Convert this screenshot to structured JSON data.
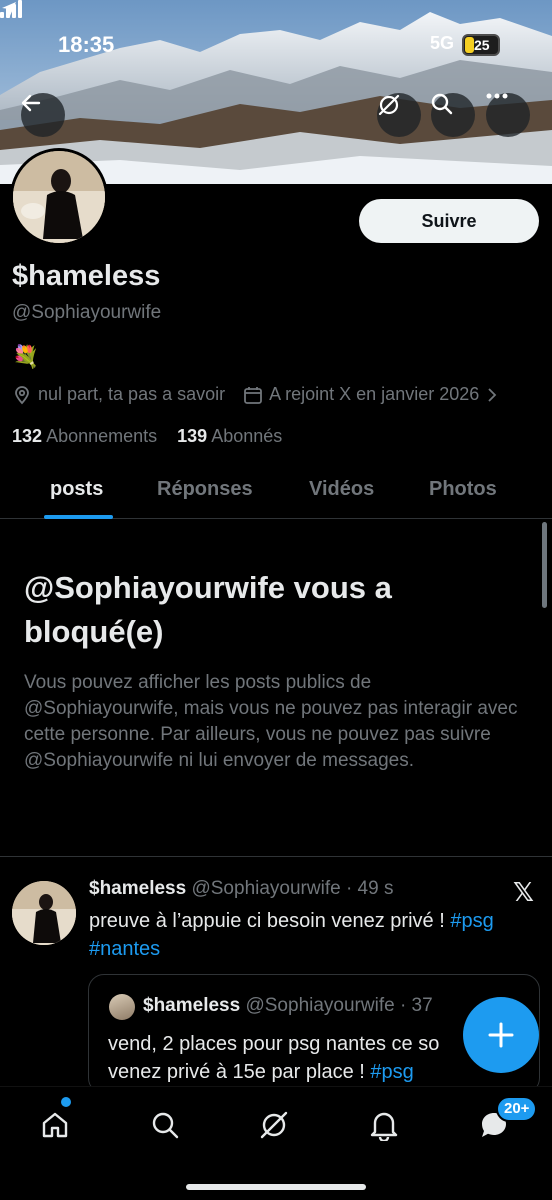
{
  "status_bar": {
    "time": "18:35",
    "network": "5G",
    "battery": "25",
    "battery_level": 0.25,
    "battery_color": "#f5cf22"
  },
  "header": {
    "icons": [
      "back-arrow-icon",
      "grok-icon",
      "search-icon",
      "more-icon"
    ]
  },
  "profile": {
    "follow_label": "Suivre",
    "name": "$hameless",
    "handle": "@Sophiayourwife",
    "bio": "💐",
    "location": "nul part, ta pas a savoir",
    "joined": "A rejoint X en janvier 2026",
    "following_count": "132",
    "following_label": "Abonnements",
    "followers_count": "139",
    "followers_label": "Abonnés"
  },
  "tabs": [
    {
      "label": "posts",
      "active": true
    },
    {
      "label": "Réponses",
      "active": false
    },
    {
      "label": "Vidéos",
      "active": false
    },
    {
      "label": "Photos",
      "active": false
    }
  ],
  "blocked": {
    "title": "@Sophiayourwife vous a bloqué(e)",
    "text": "Vous pouvez afficher les posts publics de @Sophiayourwife, mais vous ne pouvez pas interagir avec cette personne. Par ailleurs, vous ne pouvez pas suivre @Sophiayourwife ni lui envoyer de messages."
  },
  "post": {
    "name": "$hameless",
    "meta": "@Sophiayourwife · 49 s",
    "text": "preuve à l’appuie ci besoin venez privé ! ",
    "tag1": "#psg",
    "tag2": "#nantes",
    "quote": {
      "name": "$hameless",
      "meta": "@Sophiayourwife · 37",
      "text": "vend, 2 places pour psg nantes ce so",
      "text2": "venez privé à 15e par place  ! ",
      "tag": "#psg"
    }
  },
  "nav": {
    "badge": "20+"
  },
  "colors": {
    "accent": "#1d9bf0",
    "background": "#000000",
    "text": "#e7e9ea",
    "muted": "#71767b"
  }
}
